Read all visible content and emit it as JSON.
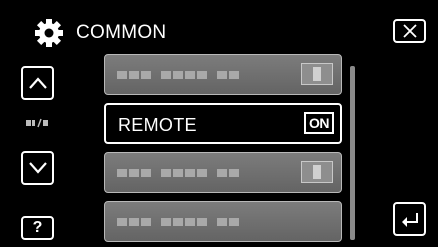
{
  "header": {
    "title": "COMMON",
    "icon": "gear-icon"
  },
  "buttons": {
    "close": {
      "icon": "close-icon"
    },
    "up": {
      "icon": "chevron-up-icon"
    },
    "down": {
      "icon": "chevron-down-icon"
    },
    "help": {
      "label": "?"
    },
    "back": {
      "icon": "return-icon"
    }
  },
  "menu": {
    "items": [
      {
        "label": "",
        "state": "disabled"
      },
      {
        "label": "REMOTE",
        "value": "ON",
        "state": "selected"
      },
      {
        "label": "",
        "state": "disabled"
      },
      {
        "label": "",
        "state": "disabled"
      }
    ]
  },
  "colors": {
    "background": "#000000",
    "item_inactive": "#6e6e6e",
    "text": "#ffffff"
  }
}
